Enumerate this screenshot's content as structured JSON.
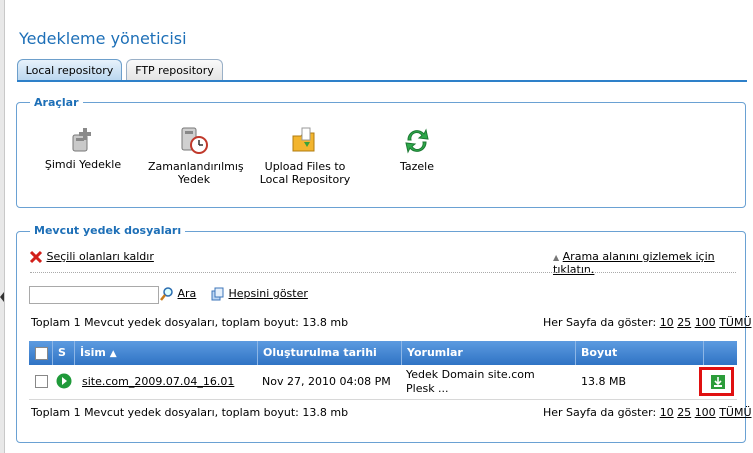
{
  "title": "Yedekleme yöneticisi",
  "tabs": [
    {
      "label": "Local repository",
      "active": true
    },
    {
      "label": "FTP repository",
      "active": false
    }
  ],
  "tools": {
    "legend": "Araçlar",
    "items": [
      {
        "label": "Şimdi Yedekle",
        "icon": "backup-plus-icon"
      },
      {
        "label": "Zamanlandırılmış Yedek",
        "icon": "scheduled-backup-icon"
      },
      {
        "label": "Upload Files to Local Repository",
        "icon": "upload-folder-icon"
      },
      {
        "label": "Tazele",
        "icon": "refresh-icon"
      }
    ]
  },
  "files": {
    "legend": "Mevcut yedek dosyaları",
    "remove_selected": "Seçili olanları kaldır",
    "hide_search": "Arama alanını gizlemek için tıklatın.",
    "search_placeholder": "",
    "search_button": "Ara",
    "show_all": "Hepsini göster",
    "summary": "Toplam 1 Mevcut yedek dosyaları, toplam boyut: 13.8 mb",
    "per_page_label": "Her Sayfa da göster:",
    "per_page_options": [
      "10",
      "25",
      "100",
      "TÜMÜ"
    ],
    "columns": {
      "s": "S",
      "name": "İsim",
      "created": "Oluşturulma tarihi",
      "comments": "Yorumlar",
      "size": "Boyut"
    },
    "rows": [
      {
        "name": "site.com_2009.07.04_16.01",
        "created": "Nov 27, 2010 04:08 PM",
        "comment_line1": "Yedek Domain site.com",
        "comment_line2": "Plesk ...",
        "size": "13.8 MB"
      }
    ]
  },
  "colors": {
    "accent": "#1d6fb7",
    "header_blue": "#2f73c4",
    "highlight_red": "#e01010"
  }
}
